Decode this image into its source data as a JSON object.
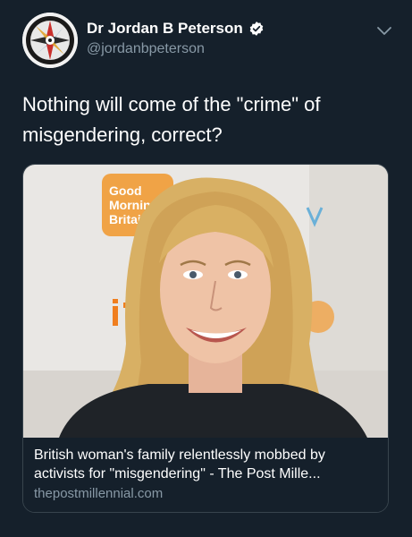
{
  "author": {
    "display_name": "Dr Jordan B Peterson",
    "handle": "@jordanbpeterson",
    "verified": true
  },
  "tweet": {
    "text_line1": "Nothing will come of the \"crime\" of",
    "text_line2": "misgendering, correct?"
  },
  "card": {
    "image_sign_text": [
      "Good",
      "Mornin",
      "Britai"
    ],
    "title_line1": "British woman's family relentlessly mobbed by",
    "title_line2": "activists for \"misgendering\" - The Post Mille...",
    "domain": "thepostmillennial.com"
  },
  "colors": {
    "background": "#15202b",
    "secondary_text": "#8899a6",
    "verified": "#ffffff",
    "card_border": "#38444d",
    "sign_orange": "#f0a346"
  },
  "icons": {
    "verified": "verified-badge-icon",
    "more": "chevron-down-icon"
  }
}
